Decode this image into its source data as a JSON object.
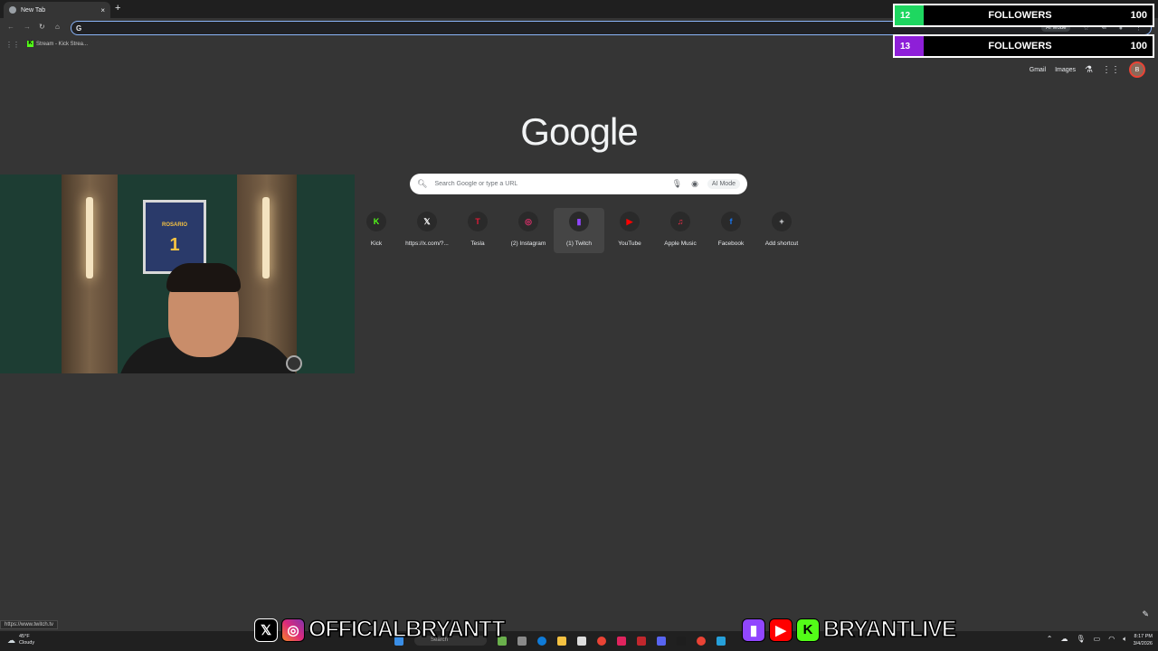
{
  "browser": {
    "tab_title": "New Tab",
    "tab_close": "×",
    "new_tab": "+",
    "window_controls": [
      "—",
      "☐",
      "×"
    ],
    "omnibox_letter": "G",
    "omnibox_value": "",
    "omni_ai_label": "AI Mode",
    "bookmark_label": "Stream - Kick Strea...",
    "bookmark_icon_letter": "K"
  },
  "google": {
    "logo": "Google",
    "links": [
      "Gmail",
      "Images"
    ],
    "avatar_letter": "B",
    "search_placeholder": "Search Google or type a URL",
    "ai_mode_label": "AI Mode"
  },
  "shortcuts": [
    {
      "label": "Kick",
      "glyph": "K",
      "color": "#53fc18"
    },
    {
      "label": "https://x.com/?...",
      "glyph": "𝕏",
      "color": "#ffffff"
    },
    {
      "label": "Tesla",
      "glyph": "T",
      "color": "#e31937"
    },
    {
      "label": "(2) Instagram",
      "glyph": "◎",
      "color": "#e1306c"
    },
    {
      "label": "(1) Twitch",
      "glyph": "▮",
      "color": "#9146ff"
    },
    {
      "label": "YouTube",
      "glyph": "▶",
      "color": "#ff0000"
    },
    {
      "label": "Apple Music",
      "glyph": "♫",
      "color": "#fa2d48"
    },
    {
      "label": "Facebook",
      "glyph": "f",
      "color": "#1877f2"
    },
    {
      "label": "Add shortcut",
      "glyph": "+",
      "color": "#e8eaed"
    }
  ],
  "followers": [
    {
      "count": "12",
      "label": "FOLLOWERS",
      "goal": "100",
      "color": "#1ed760",
      "progress": 0.12
    },
    {
      "count": "13",
      "label": "FOLLOWERS",
      "goal": "100",
      "color": "#8e1fd8",
      "progress": 0.13
    }
  ],
  "webcam": {
    "jersey_name": "ROSARIO",
    "jersey_number": "1"
  },
  "status_url": "https://www.twitch.tv",
  "social_left": {
    "handle": "OFFICIALBRYANTT"
  },
  "social_right": {
    "handle": "BRYANTLIVE"
  },
  "taskbar": {
    "weather_temp": "45°F",
    "weather_desc": "Cloudy",
    "search_label": "Search",
    "time": "8:17 PM",
    "date": "3/4/2026"
  }
}
